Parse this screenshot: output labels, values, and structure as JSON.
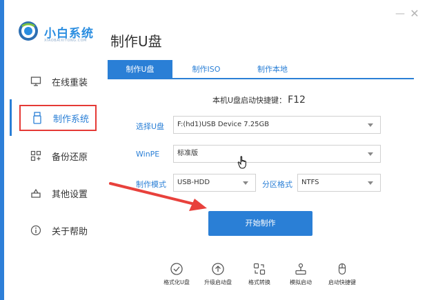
{
  "window": {
    "minimize_glyph": "—",
    "close_glyph": "✕"
  },
  "brand": {
    "name": "小白系统",
    "sub": "XIAOBAIXITONG.COM",
    "logo_icon": "xiaobai-logo-icon"
  },
  "page_title": "制作U盘",
  "sidebar": {
    "items": [
      {
        "label": "在线重装",
        "icon": "monitor-icon",
        "active": false
      },
      {
        "label": "制作系统",
        "icon": "usb-drive-icon",
        "active": true
      },
      {
        "label": "备份还原",
        "icon": "grid-icon",
        "active": false
      },
      {
        "label": "其他设置",
        "icon": "tray-icon",
        "active": false
      },
      {
        "label": "关于帮助",
        "icon": "info-icon",
        "active": false
      }
    ]
  },
  "tabs": [
    {
      "label": "制作U盘",
      "active": true
    },
    {
      "label": "制作ISO",
      "active": false
    },
    {
      "label": "制作本地",
      "active": false
    }
  ],
  "hotkey": {
    "label": "本机U盘启动快捷键：",
    "key": "F12"
  },
  "form": {
    "usb_label": "选择U盘",
    "usb_value": "F:(hd1)USB Device 7.25GB",
    "pe_label": "WinPE",
    "pe_value": "标准版",
    "mode_label": "制作模式",
    "mode_value": "USB-HDD",
    "fs_label": "分区格式",
    "fs_value": "NTFS"
  },
  "start_button": "开始制作",
  "tools": [
    {
      "label": "格式化U盘",
      "icon": "check-circle-icon"
    },
    {
      "label": "升级启动盘",
      "icon": "upload-circle-icon"
    },
    {
      "label": "格式转换",
      "icon": "convert-icon"
    },
    {
      "label": "模拟启动",
      "icon": "joystick-icon"
    },
    {
      "label": "启动快捷键",
      "icon": "mouse-icon"
    }
  ],
  "colors": {
    "accent": "#2a7fd6",
    "highlight_border": "#e53935",
    "annotation_arrow": "#e8413c"
  }
}
